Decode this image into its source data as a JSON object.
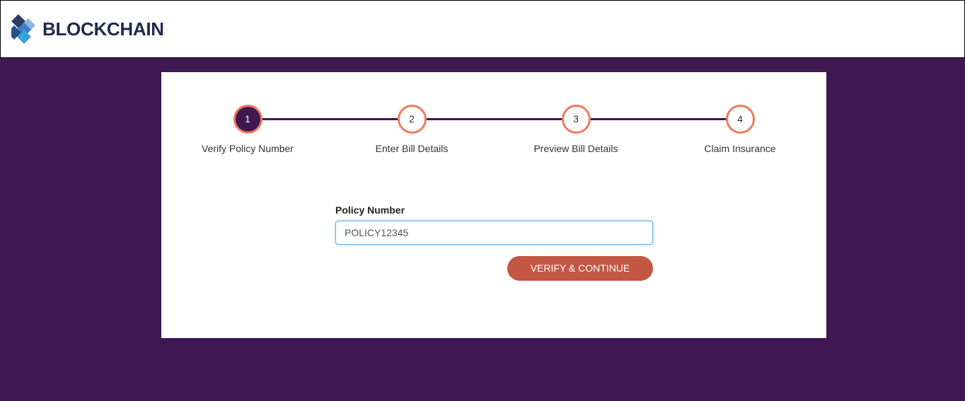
{
  "header": {
    "logo_text": "BLOCKCHAIN",
    "logo_icon": "blockchain-diamond-icon"
  },
  "stepper": {
    "steps": [
      {
        "number": "1",
        "label": "Verify Policy Number",
        "active": true
      },
      {
        "number": "2",
        "label": "Enter Bill Details",
        "active": false
      },
      {
        "number": "3",
        "label": "Preview Bill Details",
        "active": false
      },
      {
        "number": "4",
        "label": "Claim Insurance",
        "active": false
      }
    ]
  },
  "form": {
    "policy_label": "Policy Number",
    "policy_value": "POLICY12345",
    "submit_label": "VERIFY & CONTINUE"
  },
  "colors": {
    "background": "#3f1851",
    "accent": "#f07a5c",
    "button": "#c25743",
    "logo_text": "#1d2b4b"
  }
}
